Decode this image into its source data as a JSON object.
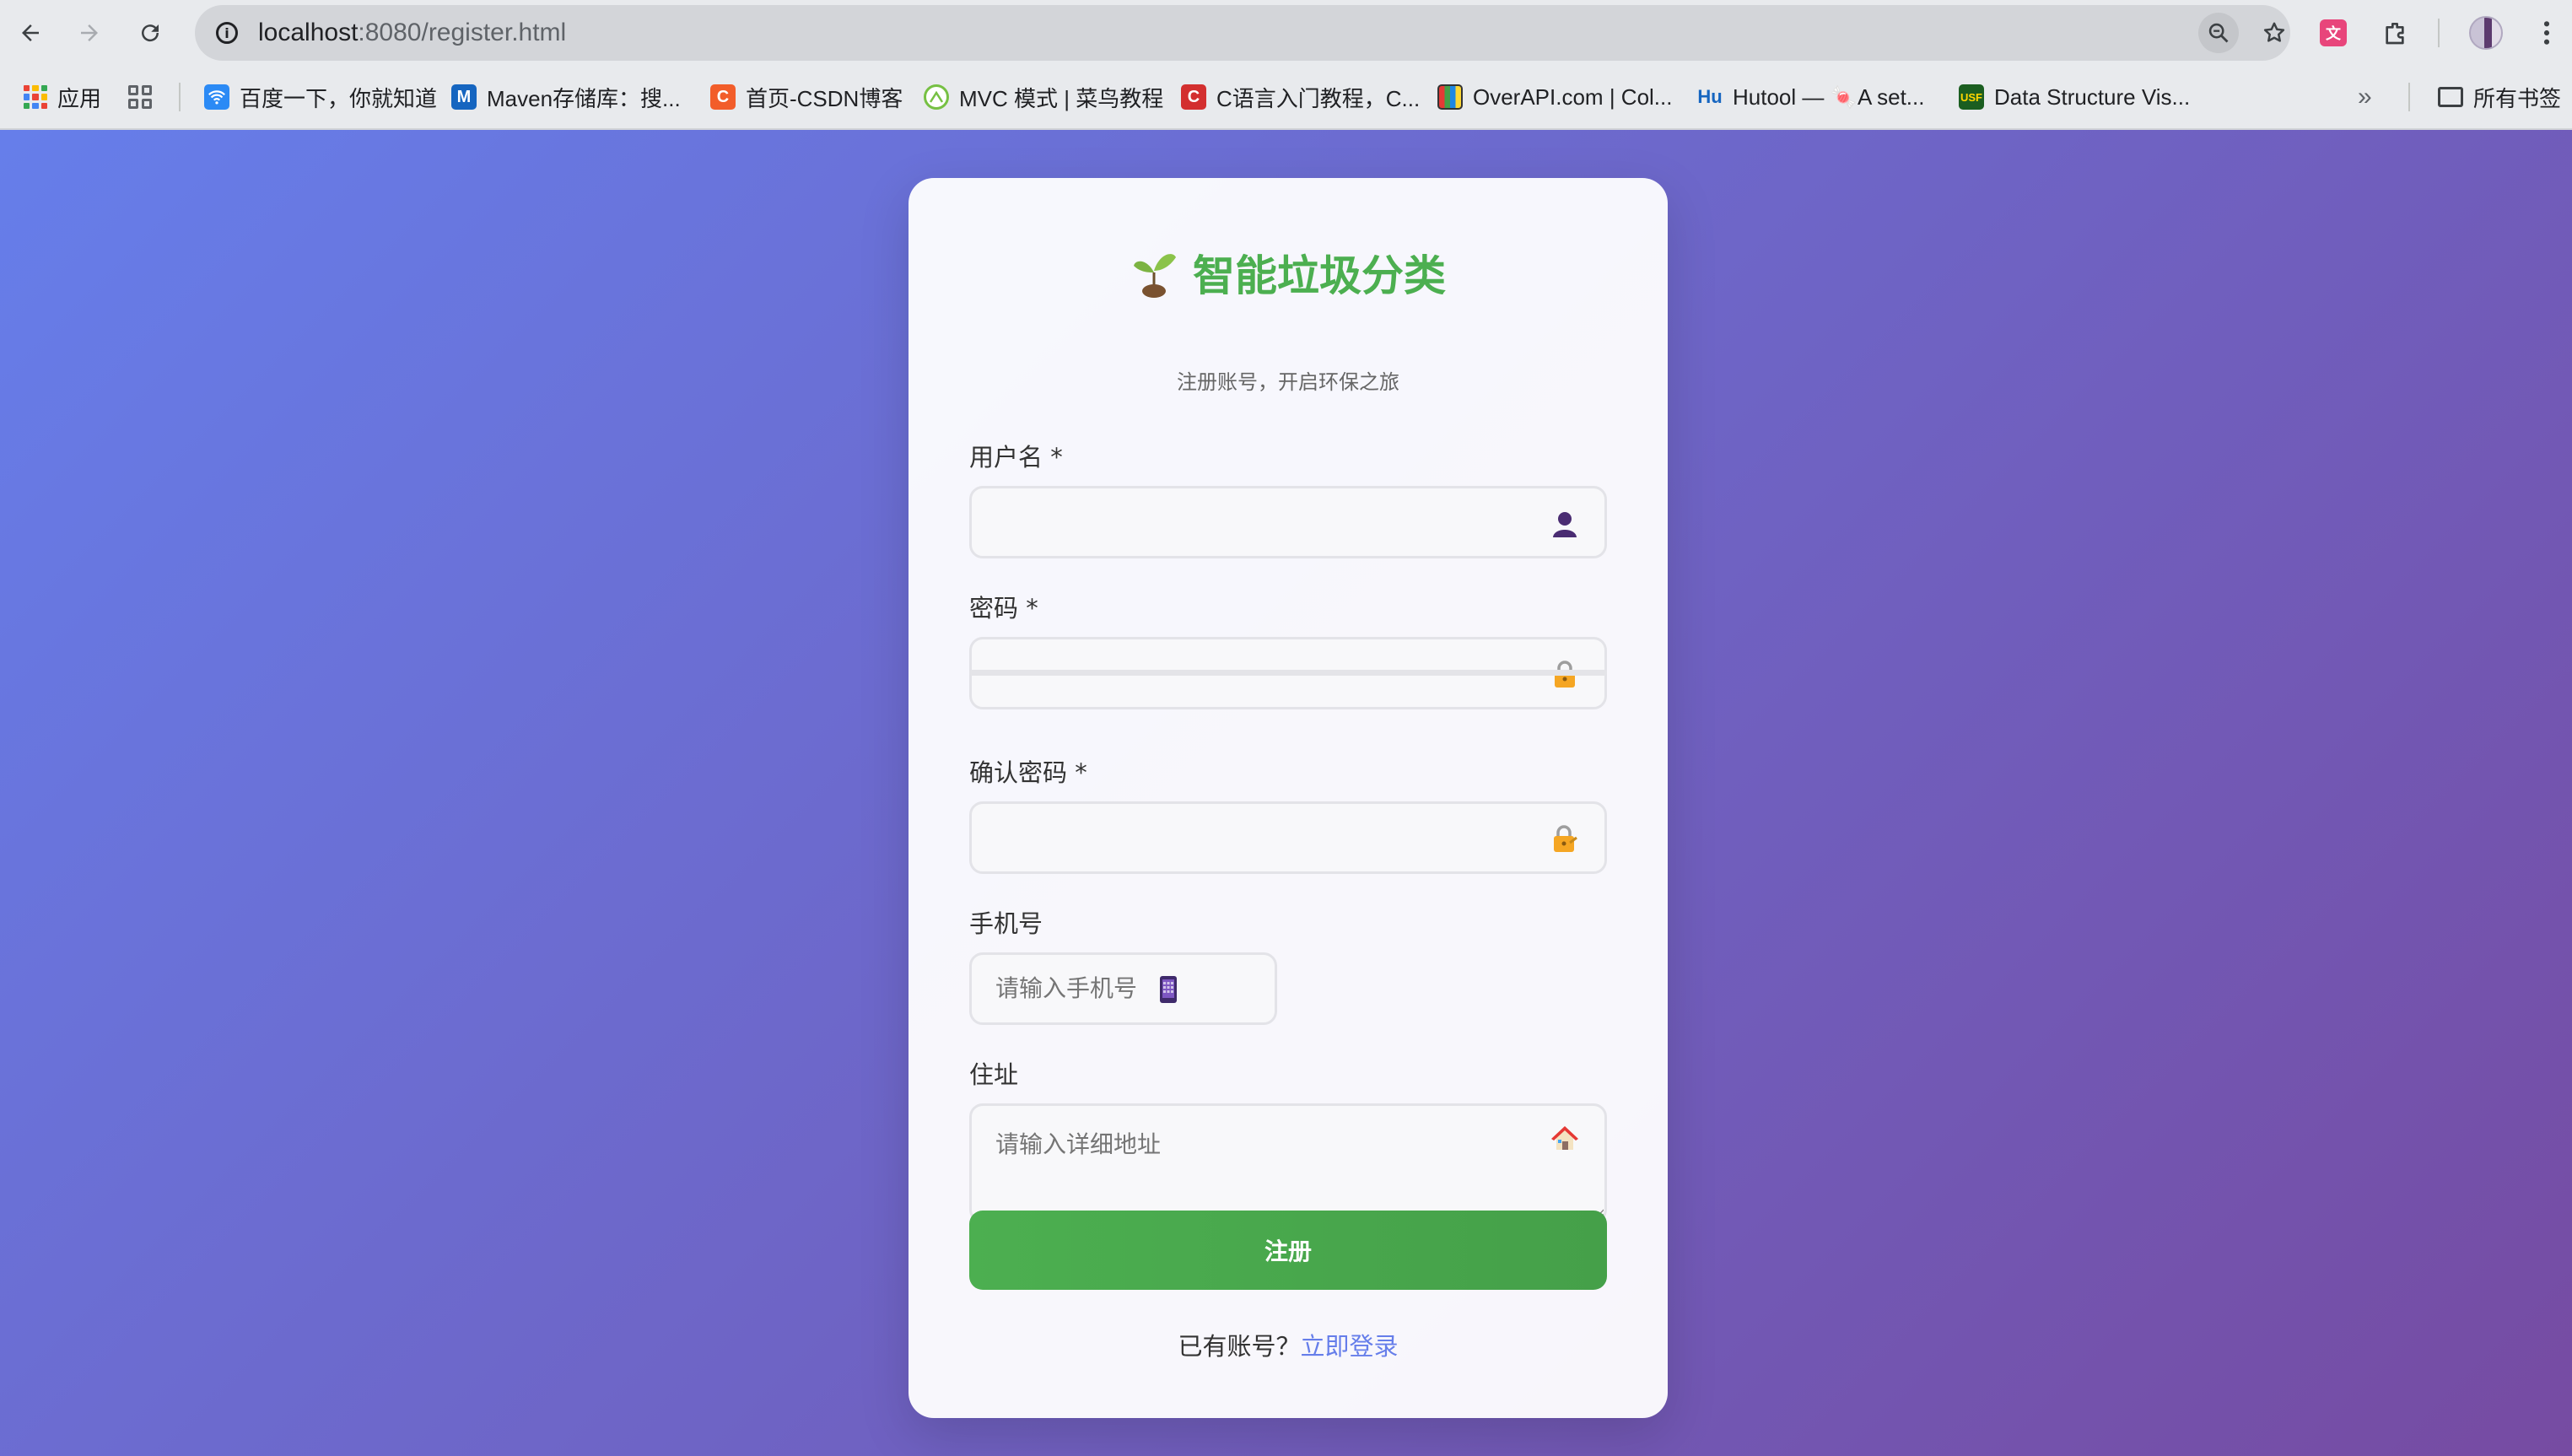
{
  "browser": {
    "url_host": "localhost",
    "url_rest": ":8080/register.html",
    "bookmarks": [
      {
        "label": "应用",
        "icon": "apps-grid-icon"
      },
      {
        "label": "百度一下，你就知道",
        "icon": "baidu-icon",
        "color": "#2b8af5"
      },
      {
        "label": "Maven存储库：搜...",
        "icon": "maven-icon",
        "color": "#1565c0",
        "glyph": "M"
      },
      {
        "label": "首页-CSDN博客",
        "icon": "csdn-icon",
        "color": "#f25d2a",
        "glyph": "C"
      },
      {
        "label": "MVC 模式 | 菜鸟教程",
        "icon": "runoob-icon",
        "color": "#76c043"
      },
      {
        "label": "C语言入门教程，C...",
        "icon": "c-tutorial-icon",
        "color": "#d32f2f",
        "glyph": "C"
      },
      {
        "label": "OverAPI.com | Col...",
        "icon": "overapi-icon"
      },
      {
        "label": "Hutool — 🍬A set...",
        "icon": "hutool-icon",
        "glyph": "Hu"
      },
      {
        "label": "Data Structure Vis...",
        "icon": "usf-icon",
        "glyph": "USF"
      }
    ],
    "all_bookmarks": "所有书签"
  },
  "register": {
    "title": "智能垃圾分类",
    "subtitle": "注册账号，开启环保之旅",
    "fields": {
      "username": {
        "label": "用户名",
        "required": "*",
        "placeholder": ""
      },
      "password": {
        "label": "密码",
        "required": "*",
        "placeholder": ""
      },
      "confirm": {
        "label": "确认密码",
        "required": "*",
        "placeholder": ""
      },
      "phone": {
        "label": "手机号",
        "placeholder": "请输入手机号"
      },
      "address": {
        "label": "住址",
        "placeholder": "请输入详细地址"
      }
    },
    "submit_label": "注册",
    "footer_text": "已有账号？",
    "login_link": "立即登录"
  },
  "colors": {
    "brand_green": "#4caf50",
    "gradient_start": "#667eea",
    "gradient_end": "#764ba2",
    "link": "#667eea"
  }
}
